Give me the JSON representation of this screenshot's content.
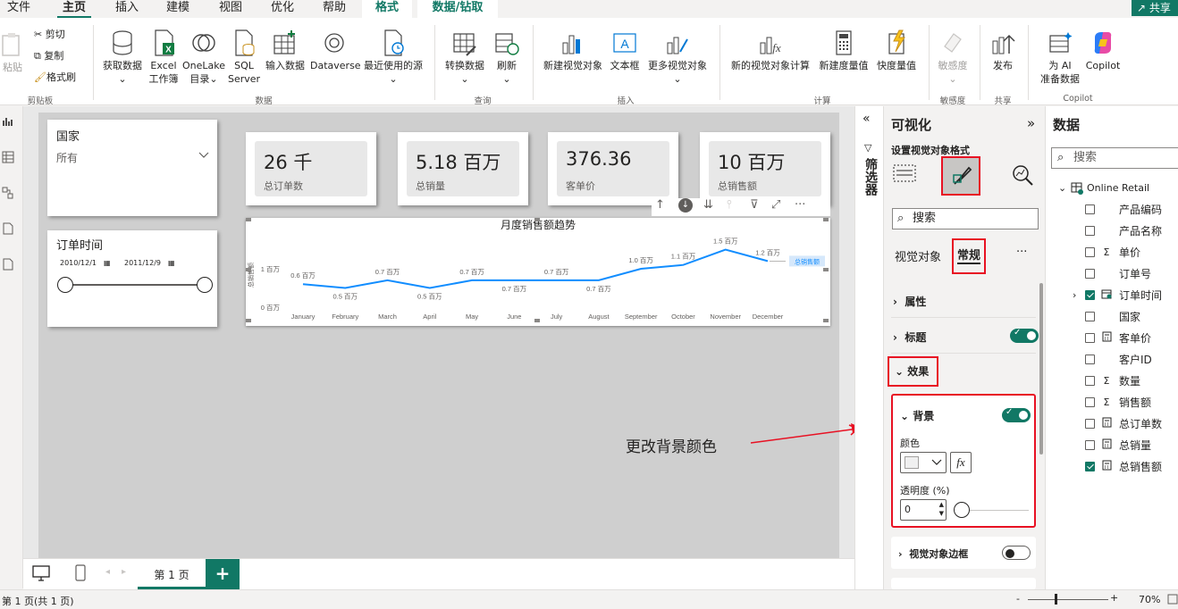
{
  "menu": {
    "tabs": [
      "文件",
      "主页",
      "插入",
      "建模",
      "视图",
      "优化",
      "帮助"
    ],
    "context_tabs": [
      "格式",
      "数据/钻取"
    ],
    "share": "共享"
  },
  "ribbon": {
    "clipboard": {
      "paste": "粘贴",
      "cut": "剪切",
      "copy": "复制",
      "format_painter": "格式刷",
      "group": "剪贴板"
    },
    "data": {
      "get_data": "获取数据",
      "excel_line1": "Excel",
      "excel_line2": "工作簿",
      "onelake_line1": "OneLake",
      "onelake_line2": "目录",
      "sql_line1": "SQL",
      "sql_line2": "Server",
      "enter_data": "输入数据",
      "dataverse": "Dataverse",
      "recent_sources": "最近使用的源",
      "group": "数据"
    },
    "query": {
      "transform": "转换数据",
      "refresh": "刷新",
      "group": "查询"
    },
    "insert": {
      "new_visual": "新建视觉对象",
      "textbox": "文本框",
      "more_visuals": "更多视觉对象",
      "group": "插入"
    },
    "calc": {
      "new_visual_calc": "新的视觉对象计算",
      "new_measure": "新建度量值",
      "quick_measure": "快度量值",
      "group": "计算"
    },
    "sensitivity": {
      "label": "敏感度",
      "group": "敏感度"
    },
    "share": {
      "publish": "发布",
      "group": "共享"
    },
    "copilot": {
      "ai_line1": "为 AI",
      "ai_line2": "准备数据",
      "copilot": "Copilot",
      "group": "Copilot"
    }
  },
  "canvas": {
    "slicer_country": {
      "title": "国家",
      "value": "所有"
    },
    "slicer_date": {
      "title": "订单时间",
      "start": "2010/12/1",
      "end": "2011/12/9",
      "start_pos": 0,
      "end_pos": 1
    },
    "kpis": [
      {
        "value": "26 千",
        "label": "总订单数"
      },
      {
        "value": "5.18 百万",
        "label": "总销量"
      },
      {
        "value": "376.36",
        "label": "客单价"
      },
      {
        "value": "10 百万",
        "label": "总销售额"
      }
    ]
  },
  "chart_data": {
    "type": "line",
    "title": "月度销售额趋势",
    "ylabel": "总销售额",
    "y_ticks": [
      "1 百万",
      "0 百万"
    ],
    "ylim": [
      0,
      2
    ],
    "categories": [
      "January",
      "February",
      "March",
      "April",
      "May",
      "June",
      "July",
      "August",
      "September",
      "October",
      "November",
      "December"
    ],
    "series": [
      {
        "name": "总销售额",
        "values": [
          0.6,
          0.5,
          0.7,
          0.5,
          0.7,
          0.7,
          0.7,
          0.7,
          1.0,
          1.1,
          1.5,
          1.2
        ],
        "labels": [
          "0.6 百万",
          "0.5 百万",
          "0.7 百万",
          "0.5 百万",
          "0.7 百万",
          "0.7 百万",
          "0.7 百万",
          "0.7 百万",
          "1.0 百万",
          "1.1 百万",
          "1.5 百万",
          "1.2 百万"
        ],
        "color": "#118dff"
      }
    ]
  },
  "annotation": {
    "text": "更改背景颜色",
    "color": "#e81123"
  },
  "pages": {
    "tab1": "第 1 页",
    "add": "+"
  },
  "status": {
    "page_info": "第 1 页(共 1 页)",
    "zoom": "70%",
    "minus": "-",
    "plus": "+"
  },
  "filters": {
    "label": "筛选器"
  },
  "viz_pane": {
    "title": "可视化",
    "subtitle": "设置视觉对象格式",
    "search_placeholder": "搜索",
    "tab_visual": "视觉对象",
    "tab_general": "常规",
    "more": "···",
    "sections": {
      "properties": "属性",
      "title": "标题",
      "effects": "效果",
      "background": "背景",
      "color_label": "颜色",
      "fx": "fx",
      "transparency_label": "透明度 (%)",
      "transparency_value": "0",
      "border": "视觉对象边框"
    }
  },
  "data_pane": {
    "title": "数据",
    "search_placeholder": "搜索",
    "table": "Online Retail",
    "fields": [
      {
        "name": "产品编码",
        "type": "",
        "checked": false
      },
      {
        "name": "产品名称",
        "type": "",
        "checked": false
      },
      {
        "name": "单价",
        "type": "Σ",
        "checked": false
      },
      {
        "name": "订单号",
        "type": "",
        "checked": false
      },
      {
        "name": "订单时间",
        "type": "cal",
        "checked": true
      },
      {
        "name": "国家",
        "type": "",
        "checked": false
      },
      {
        "name": "客单价",
        "type": "calc",
        "checked": false
      },
      {
        "name": "客户ID",
        "type": "",
        "checked": false
      },
      {
        "name": "数量",
        "type": "Σ",
        "checked": false
      },
      {
        "name": "销售额",
        "type": "Σ",
        "checked": false
      },
      {
        "name": "总订单数",
        "type": "calc",
        "checked": false
      },
      {
        "name": "总销量",
        "type": "calc",
        "checked": false
      },
      {
        "name": "总销售额",
        "type": "calc",
        "checked": true
      }
    ]
  }
}
